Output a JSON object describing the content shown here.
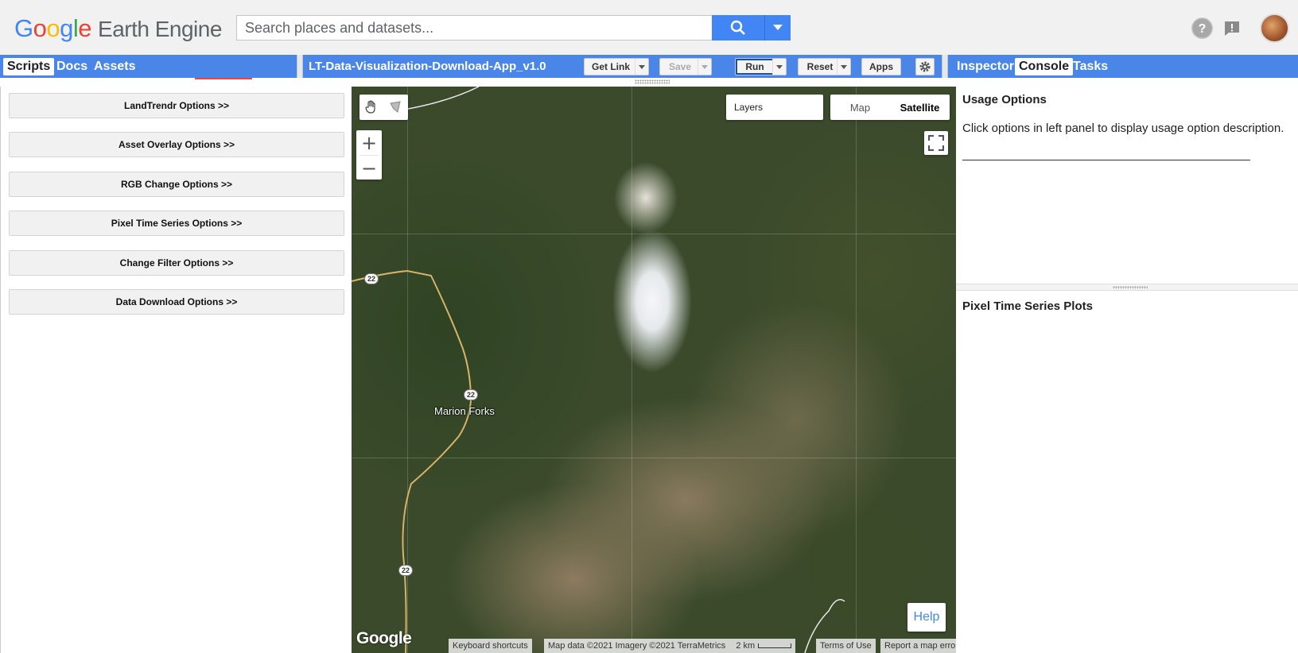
{
  "header": {
    "logo_letters": [
      "G",
      "o",
      "o",
      "g",
      "l",
      "e"
    ],
    "logo_product": "Earth Engine",
    "search_placeholder": "Search places and datasets...",
    "icons": [
      "search-icon",
      "chevron-down-icon",
      "help-icon",
      "feedback-icon",
      "avatar"
    ]
  },
  "left_tabs": [
    "Scripts",
    "Docs",
    "Assets"
  ],
  "editor": {
    "script_title": "LT-Data-Visualization-Download-App_v1.0",
    "buttons": {
      "get_link": "Get Link",
      "save": "Save",
      "run": "Run",
      "reset": "Reset",
      "apps": "Apps"
    }
  },
  "right_tabs": [
    "Inspector",
    "Console",
    "Tasks"
  ],
  "app_panel": {
    "options": [
      "LandTrendr Options >>",
      "Asset Overlay Options >>",
      "RGB Change Options >>",
      "Pixel Time Series Options >>",
      "Change Filter Options >>",
      "Data Download Options >>"
    ]
  },
  "map": {
    "layers_label": "Layers",
    "map_type_options": [
      "Map",
      "Satellite"
    ],
    "selected_map_type": "Satellite",
    "place_label": "Marion Forks",
    "road_number": "22",
    "help_label": "Help",
    "watermark": "Google",
    "attribution": {
      "keyboard": "Keyboard shortcuts",
      "map_data": "Map data ©2021 Imagery ©2021 TerraMetrics",
      "scale": "2 km",
      "terms": "Terms of Use",
      "report": "Report a map error"
    }
  },
  "usage_panel": {
    "title": "Usage Options",
    "text": "Click options in left panel to display usage option description."
  },
  "plots_panel": {
    "title": "Pixel Time Series Plots"
  },
  "colors": {
    "toolbar_blue": "#4a86e8",
    "search_blue": "#4285f4",
    "header_bg": "#f1f1f1"
  }
}
